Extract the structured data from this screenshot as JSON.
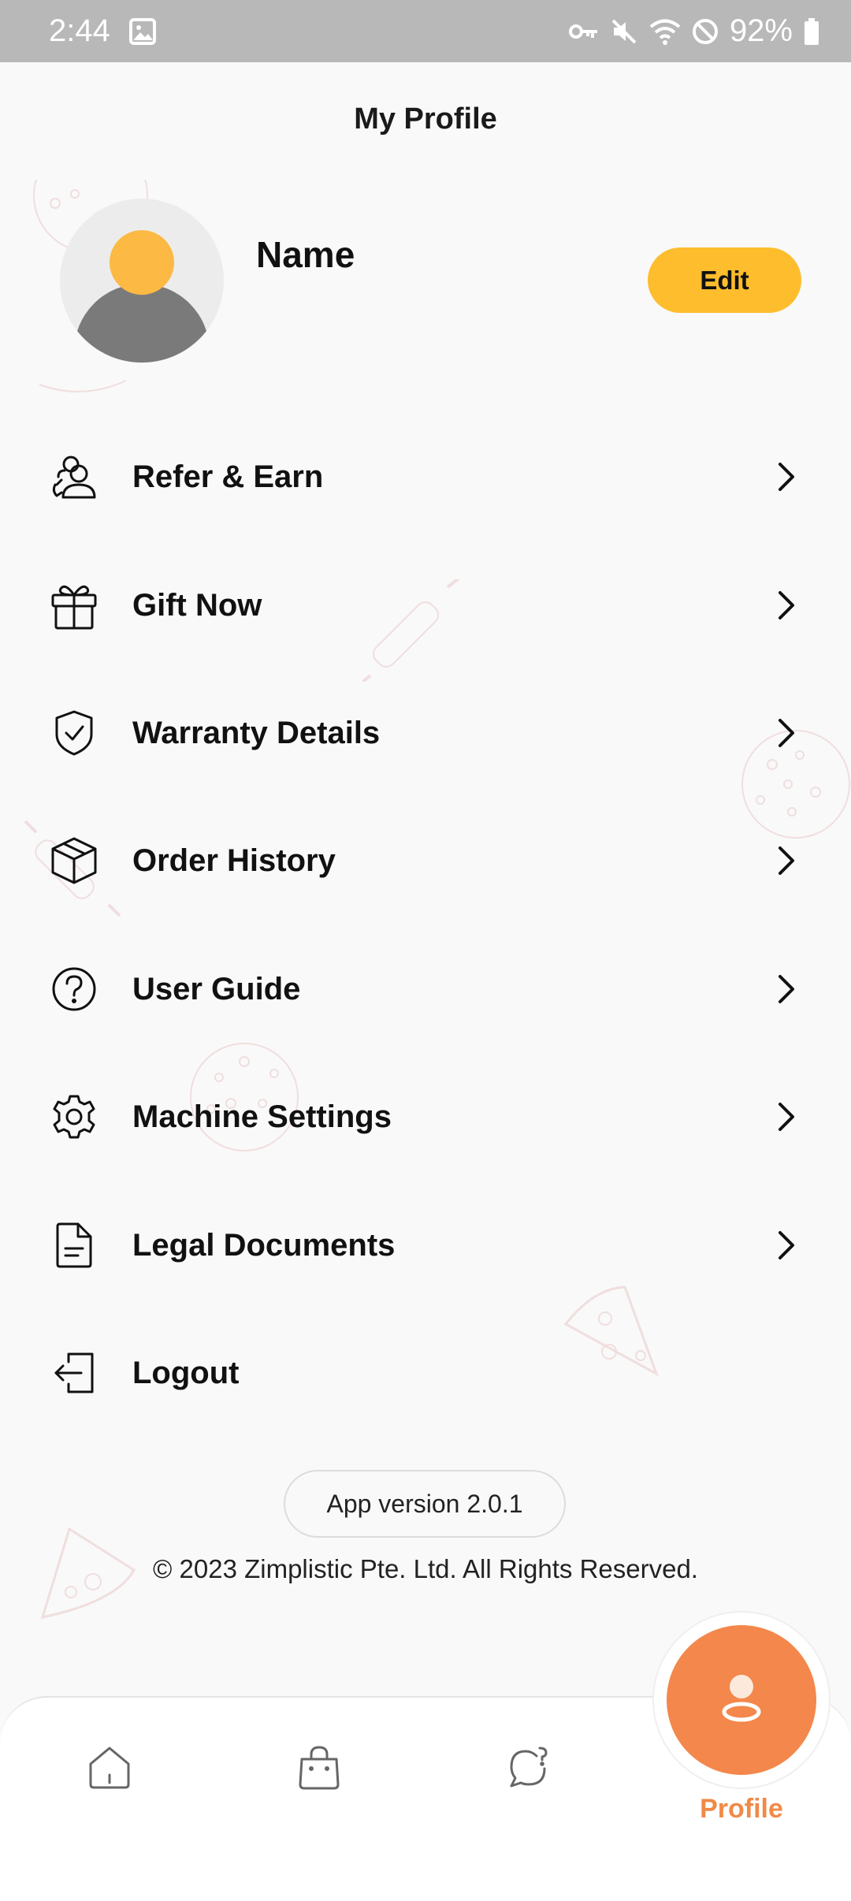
{
  "status_bar": {
    "time": "2:44",
    "battery": "92%",
    "icons": [
      "gallery-icon",
      "vpn-key-icon",
      "mute-icon",
      "wifi-icon",
      "do-not-disturb-icon",
      "battery-icon"
    ]
  },
  "header": {
    "title": "My Profile"
  },
  "profile": {
    "name": "Name",
    "edit_label": "Edit"
  },
  "menu": {
    "items": [
      {
        "label": "Refer & Earn",
        "icon": "refer-icon"
      },
      {
        "label": "Gift Now",
        "icon": "gift-icon"
      },
      {
        "label": "Warranty Details",
        "icon": "shield-check-icon"
      },
      {
        "label": "Order History",
        "icon": "box-icon"
      },
      {
        "label": "User Guide",
        "icon": "help-circle-icon"
      },
      {
        "label": "Machine Settings",
        "icon": "gear-icon"
      },
      {
        "label": "Legal Documents",
        "icon": "document-icon"
      },
      {
        "label": "Logout",
        "icon": "logout-icon"
      }
    ]
  },
  "footer": {
    "version": "App version 2.0.1",
    "copyright": "© 2023 Zimplistic Pte. Ltd. All Rights Reserved."
  },
  "bottom_nav": {
    "items": [
      "home-icon",
      "shopping-bag-icon",
      "support-chat-icon",
      "profile-icon"
    ],
    "active_label": "Profile",
    "active_color": "#f4874b"
  },
  "colors": {
    "accent_yellow": "#fdbd2d",
    "accent_orange": "#f4874b"
  }
}
